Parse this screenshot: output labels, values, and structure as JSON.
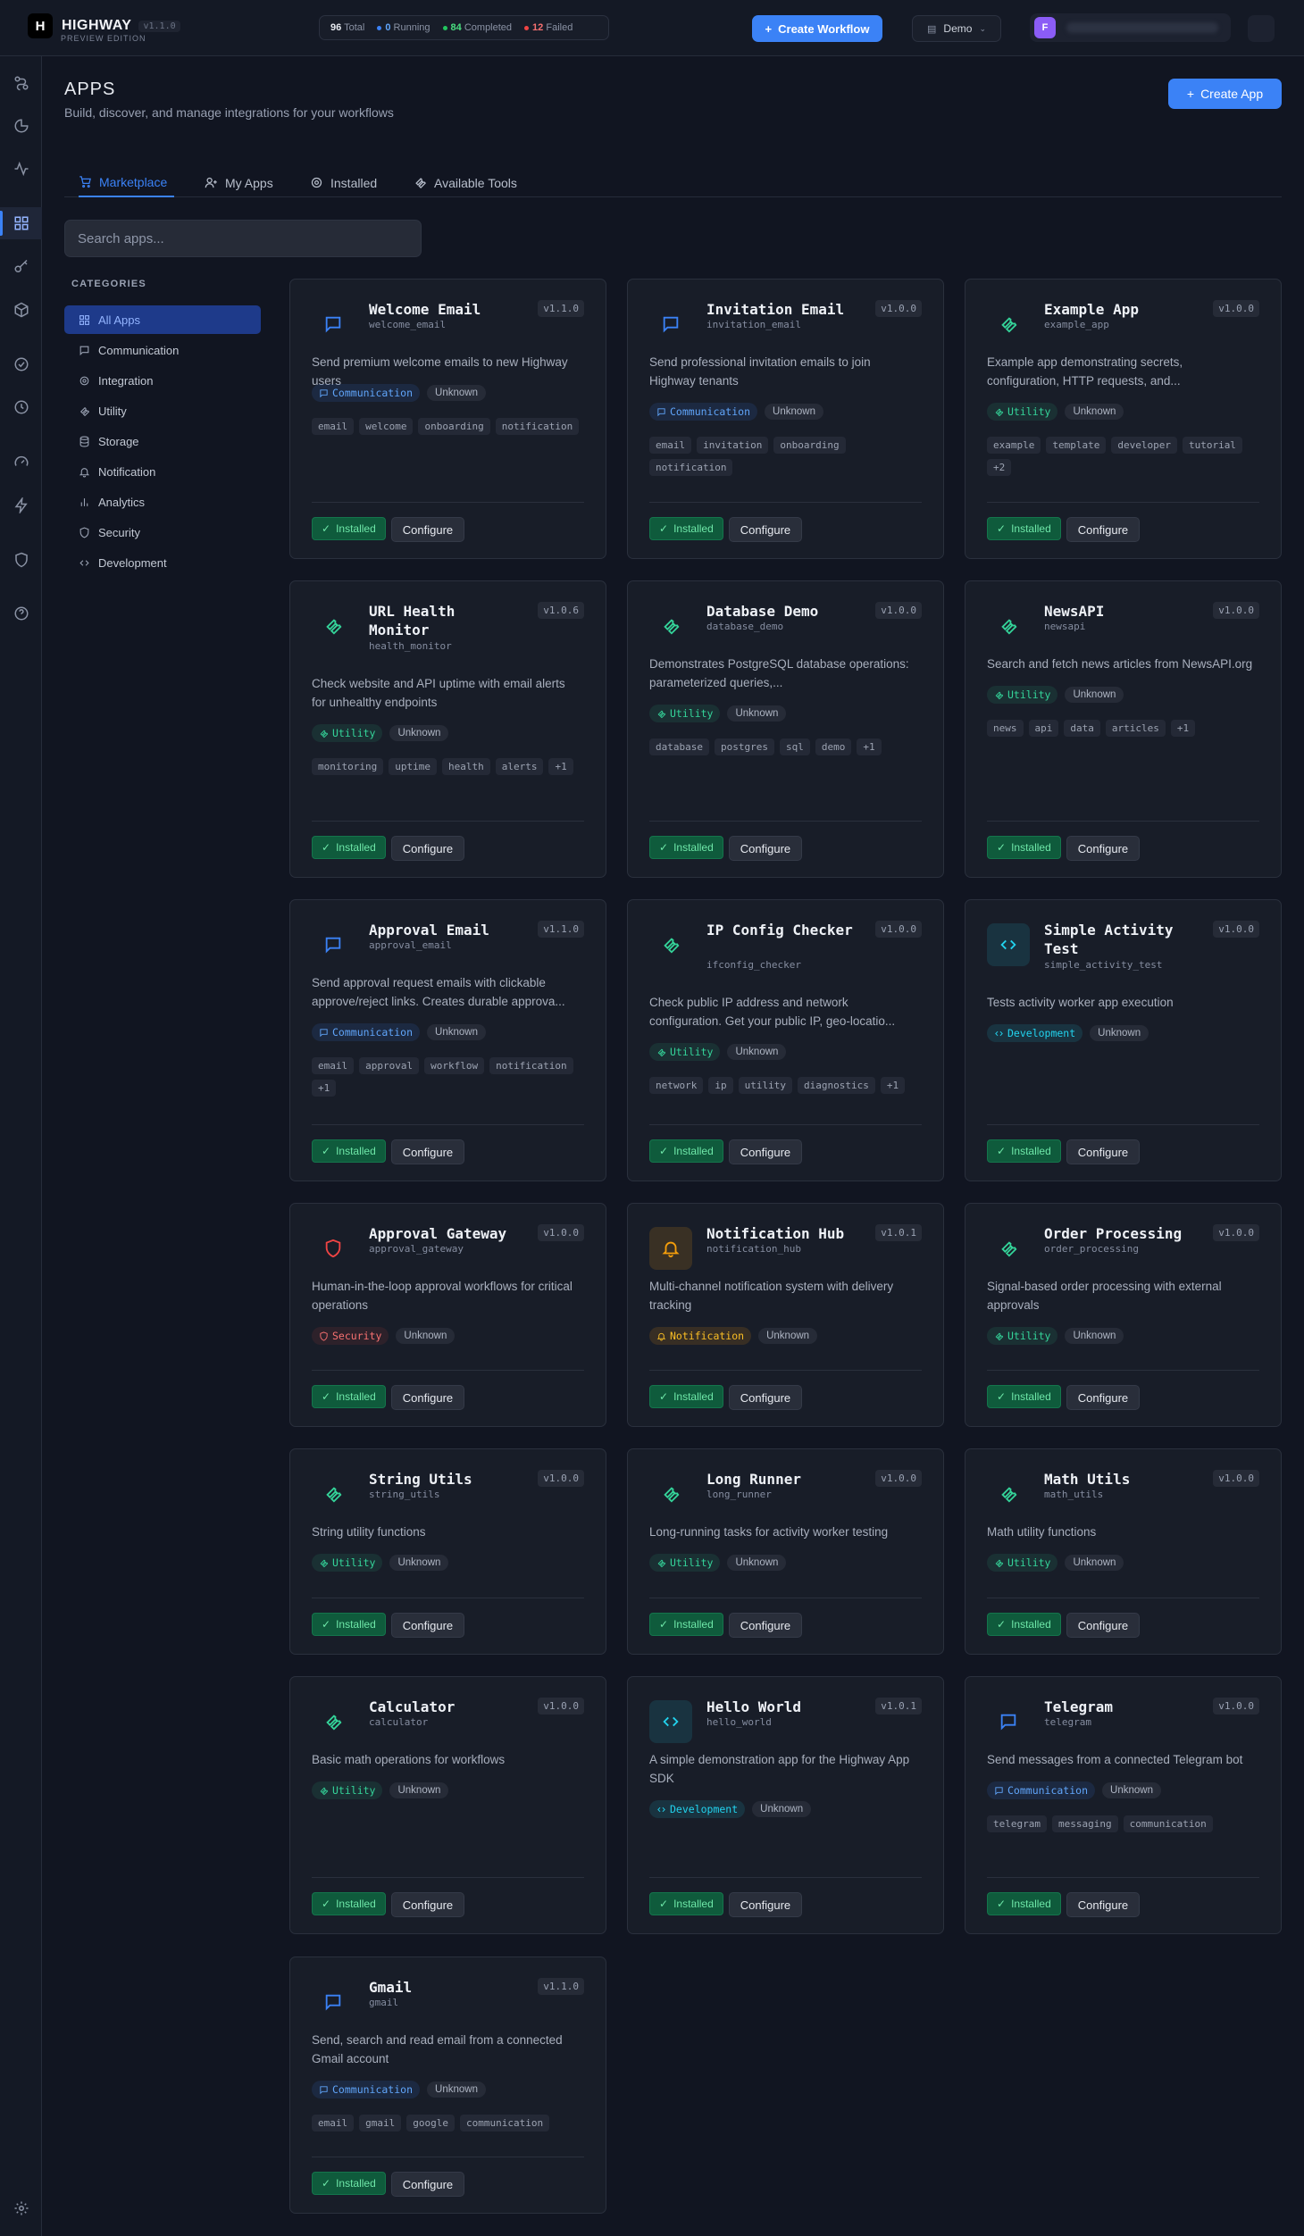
{
  "app": {
    "name": "HIGHWAY",
    "version": "v1.1.0",
    "edition": "PREVIEW EDITION"
  },
  "stats": {
    "total": "96",
    "total_label": "Total",
    "running": "0",
    "running_label": "Running",
    "completed": "84",
    "completed_label": "Completed",
    "failed": "12",
    "failed_label": "Failed"
  },
  "header": {
    "create_workflow": "Create Workflow",
    "env": "Demo",
    "avatar": "F"
  },
  "page": {
    "title": "APPS",
    "subtitle": "Build, discover, and manage integrations for your workflows",
    "create_app": "Create App"
  },
  "tabs": [
    {
      "label": "Marketplace"
    },
    {
      "label": "My Apps"
    },
    {
      "label": "Installed"
    },
    {
      "label": "Available Tools"
    }
  ],
  "search": {
    "placeholder": "Search apps..."
  },
  "categories_heading": "CATEGORIES",
  "categories": [
    {
      "label": "All Apps"
    },
    {
      "label": "Communication"
    },
    {
      "label": "Integration"
    },
    {
      "label": "Utility"
    },
    {
      "label": "Storage"
    },
    {
      "label": "Notification"
    },
    {
      "label": "Analytics"
    },
    {
      "label": "Security"
    },
    {
      "label": "Development"
    }
  ],
  "colors": {
    "accent": "#3b82f6",
    "communication": "#3b82f6",
    "utility": "#34d399",
    "development": "#22d3ee",
    "security": "#ef4444",
    "notification": "#f59e0b",
    "installed": "#6ee7a8"
  },
  "apps": [
    {
      "title": "Welcome Email",
      "slug": "welcome_email",
      "version": "v1.1.0",
      "desc": "Send premium welcome emails to new Highway users",
      "category": "Communication",
      "status": "Unknown",
      "tags": [
        "email",
        "welcome",
        "onboarding",
        "notification"
      ],
      "icon": "message-icon",
      "installed": "Installed",
      "configure": "Configure"
    },
    {
      "title": "Invitation Email",
      "slug": "invitation_email",
      "version": "v1.0.0",
      "desc": "Send professional invitation emails to join Highway tenants",
      "category": "Communication",
      "status": "Unknown",
      "tags": [
        "email",
        "invitation",
        "onboarding",
        "notification"
      ],
      "icon": "message-icon",
      "installed": "Installed",
      "configure": "Configure"
    },
    {
      "title": "Example App",
      "slug": "example_app",
      "version": "v1.0.0",
      "desc": "Example app demonstrating secrets, configuration, HTTP requests, and...",
      "category": "Utility",
      "status": "Unknown",
      "tags": [
        "example",
        "template",
        "developer",
        "tutorial",
        "+2"
      ],
      "icon": "wrench-icon",
      "installed": "Installed",
      "configure": "Configure"
    },
    {
      "title": "URL Health Monitor",
      "slug": "health_monitor",
      "version": "v1.0.6",
      "desc": "Check website and API uptime with email alerts for unhealthy endpoints",
      "category": "Utility",
      "status": "Unknown",
      "tags": [
        "monitoring",
        "uptime",
        "health",
        "alerts",
        "+1"
      ],
      "icon": "wrench-icon",
      "installed": "Installed",
      "configure": "Configure"
    },
    {
      "title": "Database Demo",
      "slug": "database_demo",
      "version": "v1.0.0",
      "desc": "Demonstrates PostgreSQL database operations: parameterized queries,...",
      "category": "Utility",
      "status": "Unknown",
      "tags": [
        "database",
        "postgres",
        "sql",
        "demo",
        "+1"
      ],
      "icon": "wrench-icon",
      "installed": "Installed",
      "configure": "Configure"
    },
    {
      "title": "NewsAPI",
      "slug": "newsapi",
      "version": "v1.0.0",
      "desc": "Search and fetch news articles from NewsAPI.org",
      "category": "Utility",
      "status": "Unknown",
      "tags": [
        "news",
        "api",
        "data",
        "articles",
        "+1"
      ],
      "icon": "wrench-icon",
      "installed": "Installed",
      "configure": "Configure"
    },
    {
      "title": "Approval Email",
      "slug": "approval_email",
      "version": "v1.1.0",
      "desc": "Send approval request emails with clickable approve/reject links. Creates durable approva...",
      "category": "Communication",
      "status": "Unknown",
      "tags": [
        "email",
        "approval",
        "workflow",
        "notification",
        "+1"
      ],
      "icon": "message-icon",
      "installed": "Installed",
      "configure": "Configure"
    },
    {
      "title": "IP Config Checker",
      "slug": "ifconfig_checker",
      "version": "v1.0.0",
      "desc": "Check public IP address and network configuration. Get your public IP, geo-locatio...",
      "category": "Utility",
      "status": "Unknown",
      "tags": [
        "network",
        "ip",
        "utility",
        "diagnostics",
        "+1"
      ],
      "icon": "wrench-icon",
      "installed": "Installed",
      "configure": "Configure"
    },
    {
      "title": "Simple Activity Test",
      "slug": "simple_activity_test",
      "version": "v1.0.0",
      "desc": "Tests activity worker app execution",
      "category": "Development",
      "status": "Unknown",
      "tags": [],
      "icon": "code-icon",
      "installed": "Installed",
      "configure": "Configure"
    },
    {
      "title": "Approval Gateway",
      "slug": "approval_gateway",
      "version": "v1.0.0",
      "desc": "Human-in-the-loop approval workflows for critical operations",
      "category": "Security",
      "status": "Unknown",
      "tags": [],
      "icon": "shield-icon",
      "installed": "Installed",
      "configure": "Configure"
    },
    {
      "title": "Notification Hub",
      "slug": "notification_hub",
      "version": "v1.0.1",
      "desc": "Multi-channel notification system with delivery tracking",
      "category": "Notification",
      "status": "Unknown",
      "tags": [],
      "icon": "bell-icon",
      "installed": "Installed",
      "configure": "Configure"
    },
    {
      "title": "Order Processing",
      "slug": "order_processing",
      "version": "v1.0.0",
      "desc": "Signal-based order processing with external approvals",
      "category": "Utility",
      "status": "Unknown",
      "tags": [],
      "icon": "wrench-icon",
      "installed": "Installed",
      "configure": "Configure"
    },
    {
      "title": "String Utils",
      "slug": "string_utils",
      "version": "v1.0.0",
      "desc": "String utility functions",
      "category": "Utility",
      "status": "Unknown",
      "tags": [],
      "icon": "wrench-icon",
      "installed": "Installed",
      "configure": "Configure"
    },
    {
      "title": "Long Runner",
      "slug": "long_runner",
      "version": "v1.0.0",
      "desc": "Long-running tasks for activity worker testing",
      "category": "Utility",
      "status": "Unknown",
      "tags": [],
      "icon": "wrench-icon",
      "installed": "Installed",
      "configure": "Configure"
    },
    {
      "title": "Math Utils",
      "slug": "math_utils",
      "version": "v1.0.0",
      "desc": "Math utility functions",
      "category": "Utility",
      "status": "Unknown",
      "tags": [],
      "icon": "wrench-icon",
      "installed": "Installed",
      "configure": "Configure"
    },
    {
      "title": "Calculator",
      "slug": "calculator",
      "version": "v1.0.0",
      "desc": "Basic math operations for workflows",
      "category": "Utility",
      "status": "Unknown",
      "tags": [],
      "icon": "wrench-icon",
      "installed": "Installed",
      "configure": "Configure"
    },
    {
      "title": "Hello World",
      "slug": "hello_world",
      "version": "v1.0.1",
      "desc": "A simple demonstration app for the Highway App SDK",
      "category": "Development",
      "status": "Unknown",
      "tags": [],
      "icon": "code-icon",
      "installed": "Installed",
      "configure": "Configure"
    },
    {
      "title": "Telegram",
      "slug": "telegram",
      "version": "v1.0.0",
      "desc": "Send messages from a connected Telegram bot",
      "category": "Communication",
      "status": "Unknown",
      "tags": [
        "telegram",
        "messaging",
        "communication"
      ],
      "icon": "message-icon",
      "installed": "Installed",
      "configure": "Configure"
    },
    {
      "title": "Gmail",
      "slug": "gmail",
      "version": "v1.1.0",
      "desc": "Send, search and read email from a connected Gmail account",
      "category": "Communication",
      "status": "Unknown",
      "tags": [
        "email",
        "gmail",
        "google",
        "communication"
      ],
      "icon": "message-icon",
      "installed": "Installed",
      "configure": "Configure"
    }
  ]
}
